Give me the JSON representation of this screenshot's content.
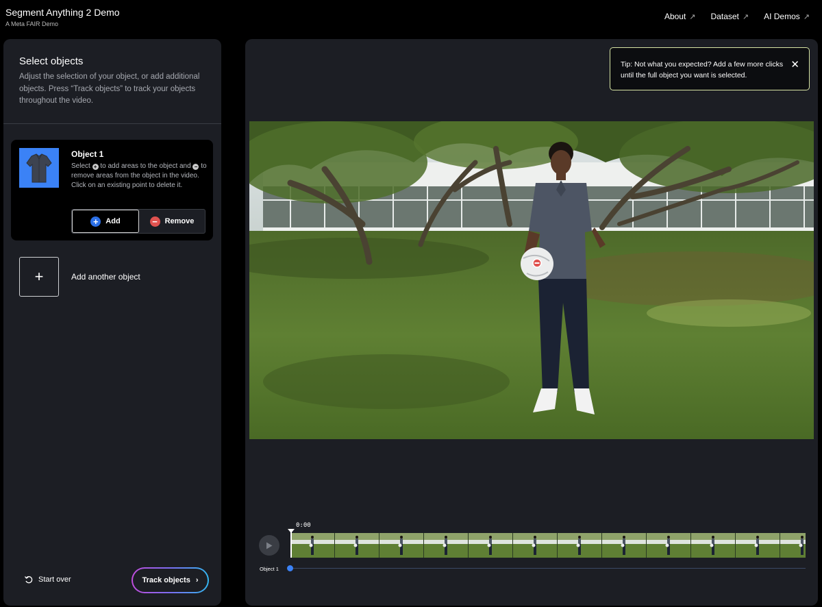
{
  "app": {
    "title": "Segment Anything 2 Demo",
    "subtitle": "A Meta FAIR Demo"
  },
  "nav": [
    {
      "label": "About",
      "icon": "external-arrow-icon"
    },
    {
      "label": "Dataset",
      "icon": "external-arrow-icon"
    },
    {
      "label": "AI Demos",
      "icon": "external-arrow-icon"
    }
  ],
  "left_panel": {
    "title": "Select objects",
    "description": "Adjust the selection of your object, or add additional objects. Press “Track objects” to track your objects throughout the video.",
    "object": {
      "name": "Object 1",
      "help_part1": "Select",
      "help_part2": "to add areas to the object and",
      "help_part3": "to remove areas from the object in the video. Click on an existing point to delete it.",
      "add_label": "Add",
      "remove_label": "Remove"
    },
    "add_another_label": "Add another object",
    "start_over_label": "Start over",
    "track_label": "Track objects"
  },
  "tip": {
    "text": "Tip: Not what you expected? Add a few more clicks until the full object you want is selected."
  },
  "timeline": {
    "timecode": "0:00",
    "track_name": "Object 1"
  },
  "colors": {
    "accent_blue": "#3b82f6",
    "remove_red": "#e0524f",
    "tip_border": "#d7e4a4",
    "panel_bg": "#1c1e24"
  }
}
